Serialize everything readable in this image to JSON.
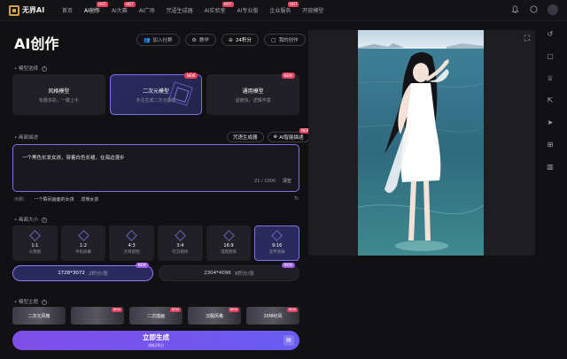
{
  "app": {
    "logo_text": "无界AI",
    "nav": [
      {
        "label": "首页",
        "active": false,
        "badge": ""
      },
      {
        "label": "AI创作",
        "active": true,
        "badge": "HOT"
      },
      {
        "label": "AI大赛",
        "active": false,
        "badge": "HOT"
      },
      {
        "label": "AI广场",
        "active": false,
        "badge": ""
      },
      {
        "label": "咒语生成器",
        "active": false,
        "badge": ""
      },
      {
        "label": "AI实验室",
        "active": false,
        "badge": "HOT"
      },
      {
        "label": "AI专业版",
        "active": false,
        "badge": ""
      },
      {
        "label": "企业服务",
        "active": false,
        "badge": "HOT"
      },
      {
        "label": "开放模型",
        "active": false,
        "badge": ""
      }
    ],
    "right_icons": [
      "bell-icon",
      "info-icon"
    ]
  },
  "header": {
    "title": "AI创作",
    "actions": [
      {
        "icon": "👥",
        "label": "加入社群"
      },
      {
        "icon": "⚙",
        "label": "教学"
      },
      {
        "icon": "⊕",
        "label": "24积分"
      },
      {
        "icon": "▢",
        "label": "我的创作"
      }
    ]
  },
  "model_section": {
    "label": "模型选择",
    "models": [
      {
        "name": "风格模型",
        "desc": "有趣多彩，一键上手",
        "selected": false,
        "badge": ""
      },
      {
        "name": "二次元模型",
        "desc": "专注生成二次元图像",
        "selected": true,
        "badge": "NEW"
      },
      {
        "name": "通用模型",
        "desc": "适度快，逻辑丰富",
        "selected": false,
        "badge": "NEW"
      }
    ]
  },
  "prompt_section": {
    "label": "画面描述",
    "tool_spell": "咒语生成器",
    "tool_ai": "AI智能描述",
    "tool_ai_badge": "NEW",
    "text": "一个黑色长发女孩，穿着白色长裙，在海边漫步",
    "count": "21 / 1000",
    "clear": "清空",
    "example_label": "示例：",
    "examples": [
      "一个瞬间画面的女孩",
      "泼辣女孩"
    ]
  },
  "size_section": {
    "label": "画面大小",
    "ratios": [
      {
        "value": "1:1",
        "name": "头像图",
        "selected": false
      },
      {
        "value": "1:2",
        "name": "手机屏幕",
        "selected": false
      },
      {
        "value": "4:3",
        "name": "文章配图",
        "selected": false
      },
      {
        "value": "3:4",
        "name": "社交媒体",
        "selected": false
      },
      {
        "value": "16:9",
        "name": "电脑壁纸",
        "selected": false
      },
      {
        "value": "9:16",
        "name": "宣传海报",
        "selected": true
      }
    ],
    "sizes": [
      {
        "label": "1728*3072",
        "sub": "2积分/张",
        "selected": true,
        "badge": "NEW"
      },
      {
        "label": "2304*4096",
        "sub": "8积分/张",
        "selected": false,
        "badge": "NEW"
      }
    ]
  },
  "theme_section": {
    "label": "模型主题",
    "themes": [
      {
        "label": "二次元风格",
        "badge": ""
      },
      {
        "label": "",
        "badge": "NEW"
      },
      {
        "label": "二次插画",
        "badge": "NEW"
      },
      {
        "label": "汉服风格",
        "badge": "NEW"
      },
      {
        "label": "20世纪风",
        "badge": "NEW"
      }
    ]
  },
  "generate": {
    "label": "立即生成",
    "cost": "消耗2积分"
  },
  "rail_icons": [
    "history-icon",
    "file-icon",
    "trophy-icon",
    "export-icon",
    "send-icon",
    "gift-icon",
    "trash-icon"
  ],
  "colors": {
    "accent": "#7d72e6",
    "badge": "#e4405f",
    "background": "#111114"
  }
}
